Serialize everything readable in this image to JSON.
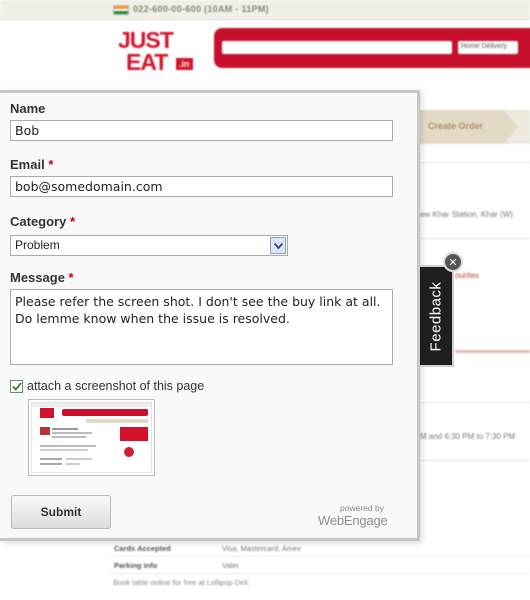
{
  "background": {
    "phone": "022-600-00-600 (10AM - 11PM)",
    "logo": {
      "line1": "JUST",
      "line2": "EAT",
      "suffix": ".in"
    },
    "search_dropdown": "Home Delivery",
    "nav_step": "Create Order",
    "address_snippet": "ew Khar Station, Khar (W)",
    "favourites_snippet": "ourites",
    "hours_snippet": "M and 6:30 PM to 7:30 PM",
    "table": [
      {
        "key": "Cards Accepted",
        "value": "Visa, Mastercard, Amex"
      },
      {
        "key": "Parking info",
        "value": "Valet"
      }
    ],
    "footer_text": "Book table online for free at Lollipop Deli."
  },
  "form": {
    "name_label": "Name",
    "name_value": "Bob",
    "email_label": "Email",
    "email_value": "bob@somedomain.com",
    "category_label": "Category",
    "category_value": "Problem",
    "message_label": "Message",
    "message_value": "Please refer the screen shot. I don't see the buy link at all.\nDo lemme know when the issue is resolved.",
    "required_marker": "*",
    "attach_label": "attach a screenshot of this page",
    "attach_checked": true,
    "submit_label": "Submit",
    "powered_by": "powered by",
    "brand": "WebEngage"
  },
  "feedback_tab": {
    "label": "Feedback",
    "close_icon": "close-icon"
  },
  "colors": {
    "brand_red": "#d6112b",
    "tab_bg": "#1f1f1f",
    "required_red": "#cc0000"
  }
}
